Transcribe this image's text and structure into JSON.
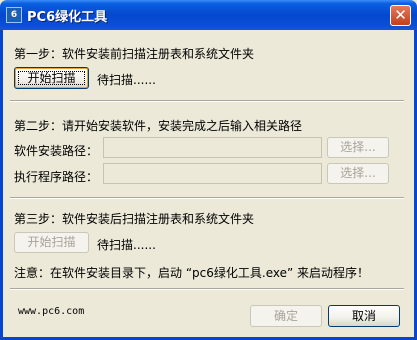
{
  "window": {
    "title": "PC6绿化工具",
    "icon": "pc6-app-icon",
    "close_glyph": "✕"
  },
  "step1": {
    "heading": "第一步：软件安装前扫描注册表和系统文件夹",
    "scan_button": "开始扫描",
    "status": "待扫描......"
  },
  "step2": {
    "heading": "第二步：请开始安装软件，安装完成之后输入相关路径",
    "install_path_label": "软件安装路径：",
    "install_path_value": "",
    "install_browse_button": "选择...",
    "exe_path_label": "执行程序路径：",
    "exe_path_value": "",
    "exe_browse_button": "选择..."
  },
  "step3": {
    "heading": "第三步：软件安装后扫描注册表和系统文件夹",
    "scan_button": "开始扫描",
    "status": "待扫描......"
  },
  "note": "注意：在软件安装目录下，启动 “pc6绿化工具.exe” 来启动程序！",
  "footer": {
    "website": "www.pc6.com",
    "ok_button": "确定",
    "cancel_button": "取消"
  },
  "colors": {
    "titlebar": "#0548d0",
    "dialog_bg": "#ece9d8",
    "button_border": "#003c74",
    "disabled_text": "#a6a498"
  }
}
